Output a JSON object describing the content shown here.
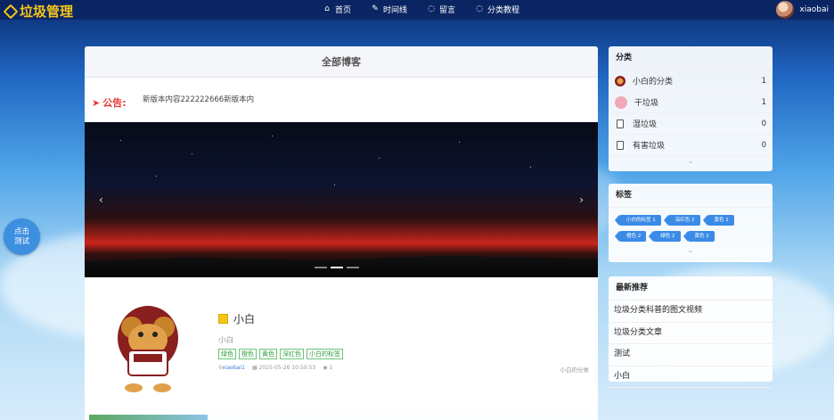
{
  "header": {
    "site_title": "垃圾管理",
    "nav": [
      {
        "label": "首页",
        "icon": "home-icon"
      },
      {
        "label": "时间线",
        "icon": "edit-icon"
      },
      {
        "label": "留言",
        "icon": "chat-icon"
      },
      {
        "label": "分类教程",
        "icon": "chat-icon"
      }
    ],
    "username": "xiaobai"
  },
  "main": {
    "title": "全部博客",
    "notice_label": "公告:",
    "notice_text": "新版本内容222222666新版本内",
    "carousel_prev": "‹",
    "carousel_next": "›",
    "post": {
      "title": "小白",
      "summary": "小白",
      "tags": [
        "绿色",
        "橙色",
        "黄色",
        "深红色",
        "小白的标签"
      ],
      "author": "xiaobai1",
      "date": "2025-05-26 10:50:53",
      "views": "1",
      "category": "小白的分类"
    }
  },
  "sidebar": {
    "categories_title": "分类",
    "categories": [
      {
        "name": "小白的分类",
        "count": "1"
      },
      {
        "name": "干垃圾",
        "count": "1"
      },
      {
        "name": "湿垃圾",
        "count": "0"
      },
      {
        "name": "有害垃圾",
        "count": "0"
      }
    ],
    "tags_title": "标签",
    "tags": [
      "小白的标签 1",
      "深红色 2",
      "黄色 1",
      "橙色 2",
      "绿色 2",
      "黄色 2"
    ],
    "recommend_title": "最新推荐",
    "recommend": [
      "垃圾分类科普的图文视频",
      "垃圾分类文章",
      "测试",
      "小白"
    ]
  },
  "fab": {
    "line1": "点击",
    "line2": "测试"
  },
  "colors": {
    "accent": "#3b8be6",
    "notice": "#e53935",
    "logo": "#f5c518"
  }
}
